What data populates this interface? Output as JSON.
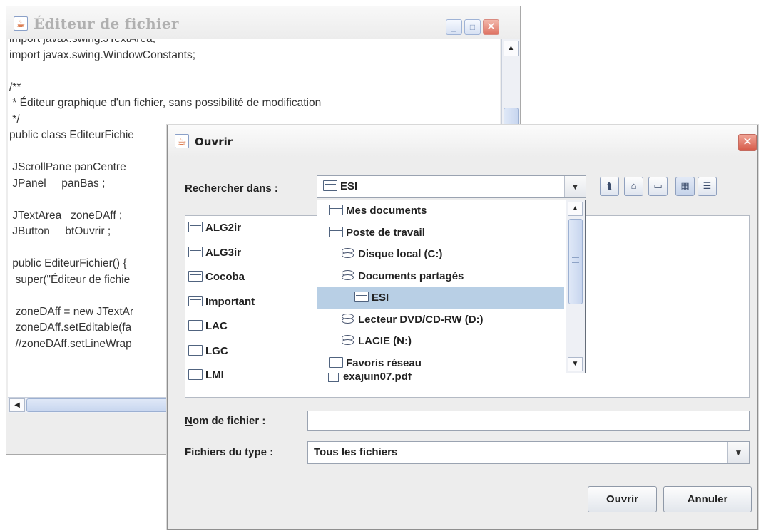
{
  "editor": {
    "title": "Éditeur de fichier",
    "icon": "java-cup-icon",
    "controls": {
      "minimize": "_",
      "maximize": "□",
      "close": "✕"
    },
    "code_lines": [
      "import javax.swing.JTextArea;",
      "import javax.swing.WindowConstants;",
      "",
      "/**",
      " * Éditeur graphique d'un fichier, sans possibilité de modification",
      " */",
      "public class EditeurFichie",
      "",
      " JScrollPane panCentre",
      " JPanel     panBas ;",
      "",
      " JTextArea   zoneDAff ;",
      " JButton     btOuvrir ;",
      "",
      " public EditeurFichier() {",
      "  super(\"Éditeur de fichie",
      "",
      "  zoneDAff = new JTextAr",
      "  zoneDAff.setEditable(fa",
      "  //zoneDAff.setLineWrap"
    ]
  },
  "dialog": {
    "title": "Ouvrir",
    "close": "✕",
    "look_in_label": "Rechercher dans :",
    "look_in_value": "ESI",
    "toolbar": {
      "up_icon": "⮬",
      "home_icon": "⌂",
      "new_folder_icon": "▭",
      "list_view_icon": "▦",
      "details_view_icon": "☰"
    },
    "files_col1": [
      "ALG2ir",
      "ALG3ir",
      "Cocoba",
      "Important",
      "LAC",
      "LGC",
      "LMI"
    ],
    "files_col2": [
      "exajuin07.pdf"
    ],
    "dropdown": [
      {
        "label": "Mes documents",
        "type": "folder",
        "indent": 0,
        "selected": false
      },
      {
        "label": "Poste de travail",
        "type": "folder",
        "indent": 0,
        "selected": false
      },
      {
        "label": "Disque local (C:)",
        "type": "drive",
        "indent": 1,
        "selected": false
      },
      {
        "label": "Documents partagés",
        "type": "drive",
        "indent": 1,
        "selected": false
      },
      {
        "label": "ESI",
        "type": "folder",
        "indent": 2,
        "selected": true
      },
      {
        "label": "Lecteur DVD/CD-RW (D:)",
        "type": "drive",
        "indent": 1,
        "selected": false
      },
      {
        "label": "LACIE (N:)",
        "type": "drive",
        "indent": 1,
        "selected": false
      },
      {
        "label": "Favoris réseau",
        "type": "folder",
        "indent": 0,
        "selected": false
      }
    ],
    "filename_label_mnemonic": "N",
    "filename_label_rest": "om de fichier :",
    "filename_value": "",
    "filetype_label": "Fichiers du type :",
    "filetype_value": "Tous les fichiers",
    "open_button": "Ouvrir",
    "cancel_button": "Annuler",
    "colors": {
      "selection": "#b8cfe5",
      "close": "#d65a48"
    }
  }
}
